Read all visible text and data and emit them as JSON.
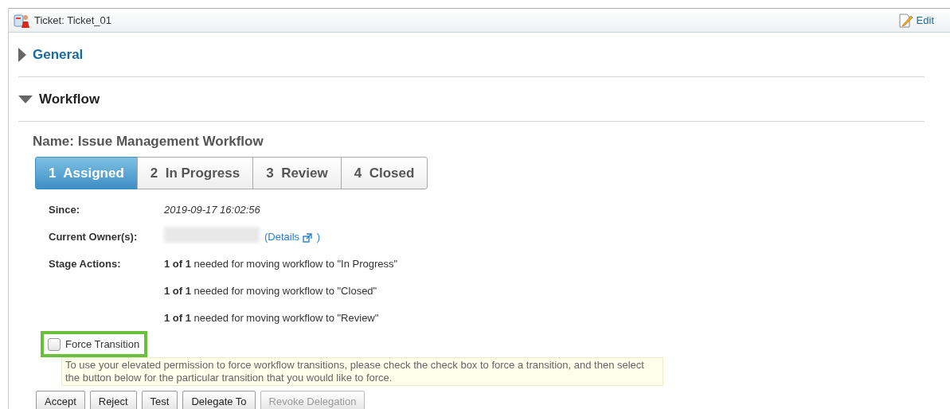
{
  "window": {
    "title": "Ticket: Ticket_01",
    "edit_link": "Edit"
  },
  "sections": [
    {
      "title": "General",
      "expanded": false
    },
    {
      "title": "Workflow",
      "expanded": true
    }
  ],
  "workflow": {
    "name": "Name: Issue Management Workflow",
    "stages": [
      {
        "number": "1",
        "label": "Assigned",
        "selected": true
      },
      {
        "number": "2",
        "label": "In Progress",
        "selected": false
      },
      {
        "number": "3",
        "label": "Review",
        "selected": false
      },
      {
        "number": "4",
        "label": "Closed",
        "selected": false
      }
    ],
    "since": {
      "label": "Since:",
      "value": "2019-09-17 16:02:56"
    },
    "owner": {
      "label": "Current Owner(s):",
      "details_link": "(Details",
      "close_paren": ")"
    },
    "stage_actions": {
      "label": "Stage Actions:",
      "items": [
        "**1 of 1** needed for moving workflow to \"In Progress\"",
        "**1 of 1** needed for moving workflow to \"Closed\"",
        "**1 of 1** needed for moving workflow to \"Review\""
      ]
    },
    "force_transition": {
      "label": "Force Transition",
      "checked": false,
      "highlighted": true
    },
    "help_text": "To use your elevated permission to force workflow transitions, please check the check box to force a transition, and then select the button below for the particular transition that you would like to force.",
    "buttons": [
      {
        "label": "Accept",
        "disabled": false
      },
      {
        "label": "Reject",
        "disabled": false
      },
      {
        "label": "Test",
        "disabled": false
      },
      {
        "label": "Delegate To",
        "disabled": false
      },
      {
        "label": "Revoke Delegation",
        "disabled": true
      }
    ]
  }
}
